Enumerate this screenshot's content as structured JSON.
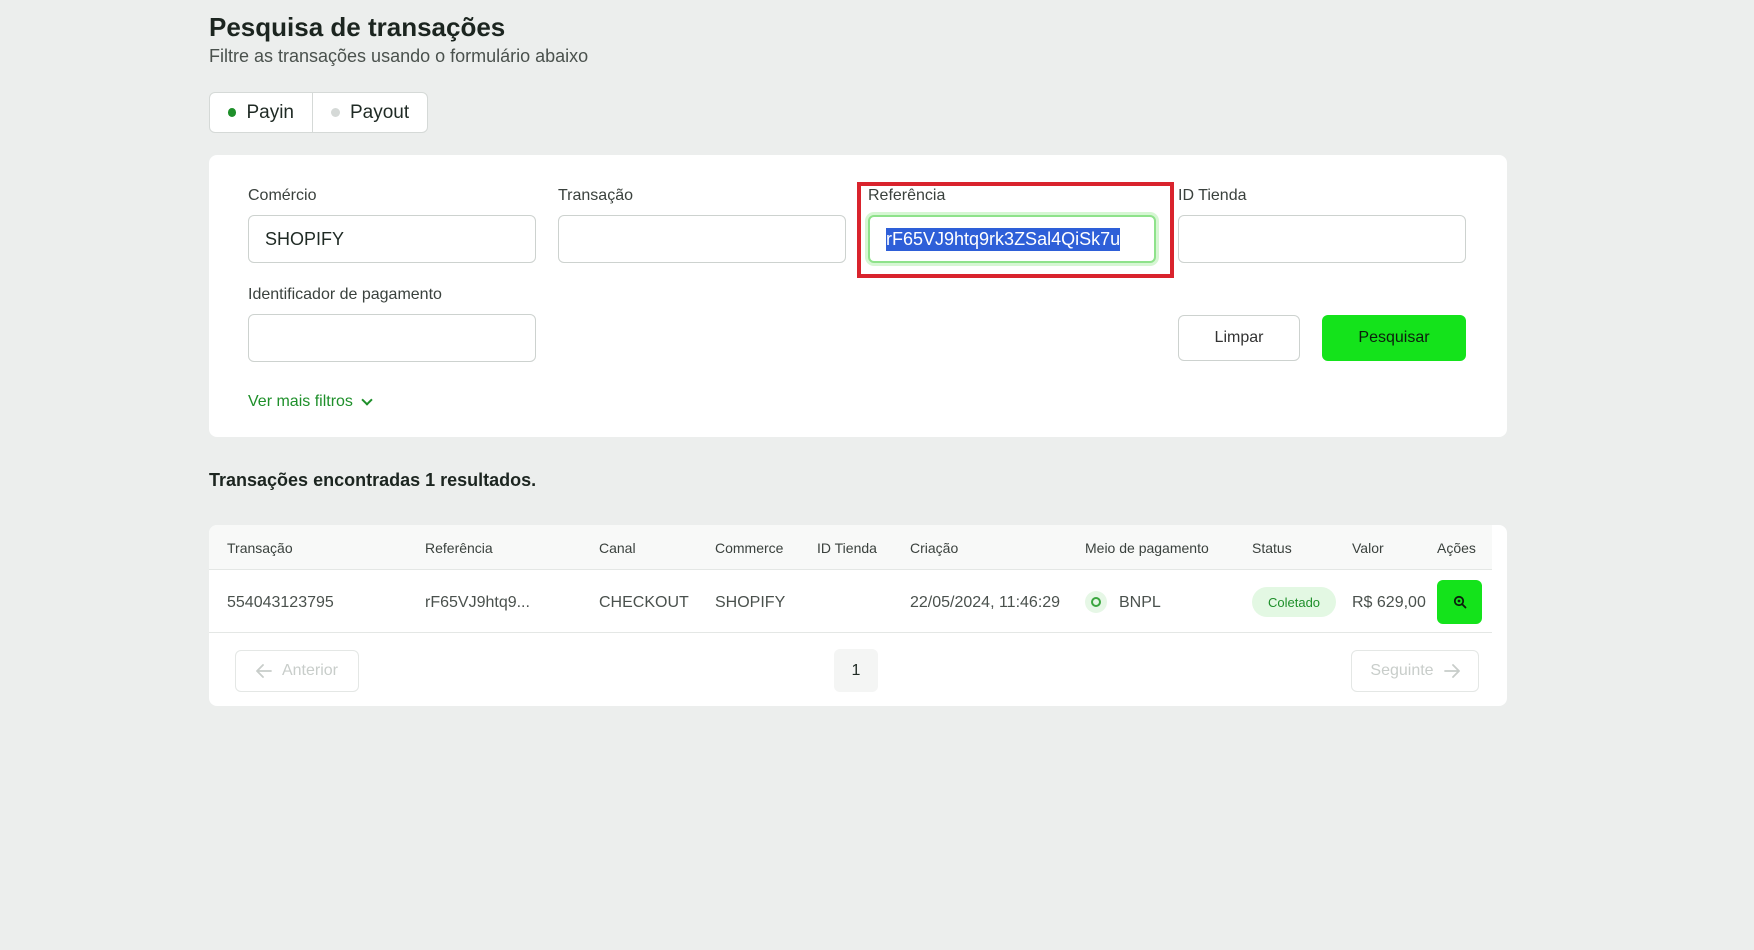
{
  "header": {
    "title": "Pesquisa de transações",
    "subtitle": "Filtre as transações usando o formulário abaixo"
  },
  "toggle": {
    "payin_label": "Payin",
    "payout_label": "Payout",
    "active": "Payin",
    "active_dot_color": "#1e8f2a",
    "inactive_dot_color": "#d5d9d7"
  },
  "filters": {
    "comercio_label": "Comércio",
    "comercio_value": "SHOPIFY",
    "transacao_label": "Transação",
    "transacao_value": "",
    "referencia_label": "Referência",
    "referencia_value": "rF65VJ9htq9rk3ZSal4QiSk7u",
    "id_tienda_label": "ID Tienda",
    "id_tienda_value": "",
    "identificador_label": "Identificador de pagamento",
    "identificador_value": "",
    "clear_label": "Limpar",
    "search_label": "Pesquisar",
    "more_filters_label": "Ver mais filtros"
  },
  "results": {
    "title": "Transações encontradas 1 resultados.",
    "columns": [
      "Transação",
      "Referência",
      "Canal",
      "Commerce",
      "ID Tienda",
      "Criação",
      "Meio de pagamento",
      "Status",
      "Valor",
      "Ações"
    ],
    "rows": [
      {
        "transacao": "554043123795",
        "referencia": "rF65VJ9htq9...",
        "canal": "CHECKOUT",
        "commerce": "SHOPIFY",
        "id_tienda": "",
        "criacao": "22/05/2024, 11:46:29",
        "meio_pagamento": "BNPL",
        "status": "Coletado",
        "valor": "R$ 629,00"
      }
    ]
  },
  "pagination": {
    "prev_label": "Anterior",
    "next_label": "Seguinte",
    "current_page": "1"
  },
  "colors": {
    "accent": "#14e31b",
    "link": "#1e8f2a",
    "highlight_box": "#d9232d"
  }
}
